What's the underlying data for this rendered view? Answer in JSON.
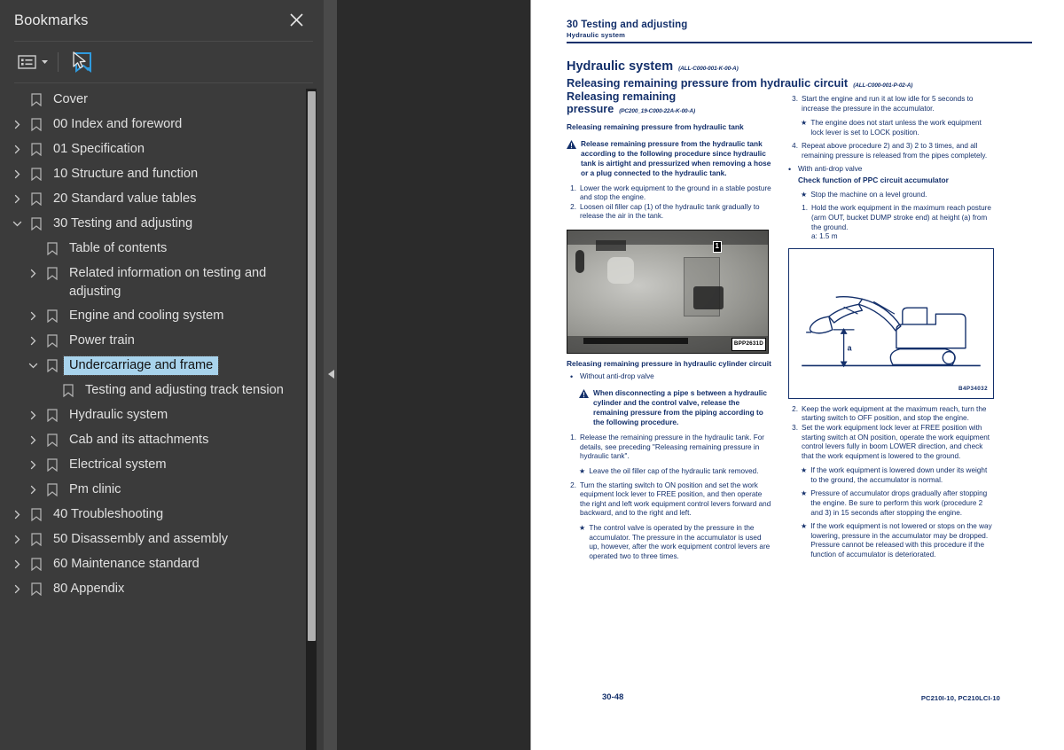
{
  "panel": {
    "title": "Bookmarks",
    "close_label": "×",
    "toolbar": {
      "options_label": "Bookmark options",
      "expand_label": "Expand current bookmark"
    }
  },
  "bookmarks": [
    {
      "label": "Cover",
      "level": 0,
      "twisty": "none",
      "selected": false
    },
    {
      "label": "00 Index and foreword",
      "level": 0,
      "twisty": "collapsed",
      "selected": false
    },
    {
      "label": "01 Specification",
      "level": 0,
      "twisty": "collapsed",
      "selected": false
    },
    {
      "label": "10 Structure and function",
      "level": 0,
      "twisty": "collapsed",
      "selected": false
    },
    {
      "label": "20 Standard value tables",
      "level": 0,
      "twisty": "collapsed",
      "selected": false
    },
    {
      "label": "30 Testing and adjusting",
      "level": 0,
      "twisty": "expanded",
      "selected": false
    },
    {
      "label": "Table of contents",
      "level": 1,
      "twisty": "none",
      "selected": false
    },
    {
      "label": "Related information on testing and adjusting",
      "level": 1,
      "twisty": "collapsed",
      "selected": false
    },
    {
      "label": "Engine and cooling system",
      "level": 1,
      "twisty": "collapsed",
      "selected": false
    },
    {
      "label": "Power train",
      "level": 1,
      "twisty": "collapsed",
      "selected": false
    },
    {
      "label": "Undercarriage and frame",
      "level": 1,
      "twisty": "expanded",
      "selected": true
    },
    {
      "label": "Testing and adjusting track tension",
      "level": 2,
      "twisty": "none",
      "selected": false
    },
    {
      "label": "Hydraulic system",
      "level": 1,
      "twisty": "collapsed",
      "selected": false
    },
    {
      "label": "Cab and its attachments",
      "level": 1,
      "twisty": "collapsed",
      "selected": false
    },
    {
      "label": "Electrical system",
      "level": 1,
      "twisty": "collapsed",
      "selected": false
    },
    {
      "label": "Pm clinic",
      "level": 1,
      "twisty": "collapsed",
      "selected": false
    },
    {
      "label": "40 Troubleshooting",
      "level": 0,
      "twisty": "collapsed",
      "selected": false
    },
    {
      "label": "50 Disassembly and assembly",
      "level": 0,
      "twisty": "collapsed",
      "selected": false
    },
    {
      "label": "60 Maintenance standard",
      "level": 0,
      "twisty": "collapsed",
      "selected": false
    },
    {
      "label": "80 Appendix",
      "level": 0,
      "twisty": "collapsed",
      "selected": false
    }
  ],
  "document": {
    "header": {
      "chapter": "30 Testing and adjusting",
      "section": "Hydraulic system"
    },
    "h1": {
      "text": "Hydraulic system",
      "code": "(ALL-C000-001-K-00-A)"
    },
    "h2": {
      "text": "Releasing remaining pressure from hydraulic circuit",
      "code": "(ALL-C000-001-P-02-A)"
    },
    "left_column": {
      "h3_line1": "Releasing remaining",
      "h3_line2": "pressure",
      "h3_code": "(PC200_19-C000-22A-K-00-A)",
      "h4": "Releasing remaining pressure from hydraulic tank",
      "warning1": "Release remaining pressure from the hydraulic tank according to the following procedure since hydraulic tank is airtight and pressurized when removing a hose or a plug connected to the hydraulic tank.",
      "steps1": [
        {
          "n": "1.",
          "t": "Lower the work equipment to the ground in a stable posture and stop the engine."
        },
        {
          "n": "2.",
          "t": "Loosen oil filler cap (1) of the hydraulic tank gradually to release the air in the tank."
        }
      ],
      "photo": {
        "code": "BPP2631D",
        "callout": "1"
      },
      "h4b": "Releasing remaining pressure in hydraulic cylinder circuit",
      "bullet1": "Without anti-drop valve",
      "warning2": "When disconnecting a pipe s  between a hydraulic cylinder and the control valve, release the remaining pressure from the piping according to the following procedure.",
      "steps2": [
        {
          "n": "1.",
          "t": "Release the remaining pressure in the hydraulic tank. For details, see preceding \"Releasing remaining pressure in hydraulic tank\"."
        }
      ],
      "star1": "Leave the oil filler cap of the hydraulic tank removed.",
      "steps3": [
        {
          "n": "2.",
          "t": "Turn the starting switch to ON position and set the work equipment lock lever to FREE position, and then operate the right and left work equipment control levers forward and backward, and to the right and left."
        }
      ],
      "star2": "The control valve is operated by the pressure in the accumulator. The pressure in the accumulator is used up, however, after the work equipment control levers are operated two to three times."
    },
    "right_column": {
      "steps1": [
        {
          "n": "3.",
          "t": "Start the engine and run it at low idle for 5 seconds to increase the pressure in the accumulator."
        }
      ],
      "star1": "The engine does not start unless the work equipment lock lever is set to LOCK position.",
      "steps2": [
        {
          "n": "4.",
          "t": "Repeat above procedure 2) and 3) 2 to 3 times, and all remaining pressure is released from the pipes completely."
        }
      ],
      "bullet1": "With anti-drop valve",
      "h4": "Check function of PPC circuit accumulator",
      "star2": "Stop the machine on a level ground.",
      "steps3": [
        {
          "n": "1.",
          "t": "Hold the work equipment in the maximum reach posture (arm OUT, bucket DUMP stroke end) at height (a) from the ground."
        }
      ],
      "dim": "a: 1.5 m",
      "figure": {
        "code": "B4P34032",
        "label": "a"
      },
      "steps4": [
        {
          "n": "2.",
          "t": "Keep the work equipment at the maximum reach, turn the starting switch to OFF position, and stop the engine."
        },
        {
          "n": "3.",
          "t": "Set the work equipment lock lever at FREE position with starting switch at ON position, operate the work equipment control levers fully in boom LOWER direction, and check that the work equipment is lowered to the ground."
        }
      ],
      "star3": "If the work equipment is lowered down under its weight to the ground, the accumulator is normal.",
      "star4": "Pressure of accumulator drops gradually after stopping the engine. Be sure to perform this work (procedure 2 and 3) in 15 seconds after stopping the engine.",
      "star5": "If the work equipment is not lowered or stops on the way lowering, pressure in the accumulator may be dropped. Pressure cannot be released with this procedure if the function of accumulator is deteriorated."
    },
    "footer": {
      "page_number": "30-48",
      "model": "PC210I-10, PC210LCI-10"
    }
  },
  "colors": {
    "panel_bg": "#3b3b3b",
    "viewer_bg": "#2b2b2b",
    "selection": "#a8d3ec",
    "accent_icon": "#2f9bdf",
    "doc_text": "#14306b"
  }
}
